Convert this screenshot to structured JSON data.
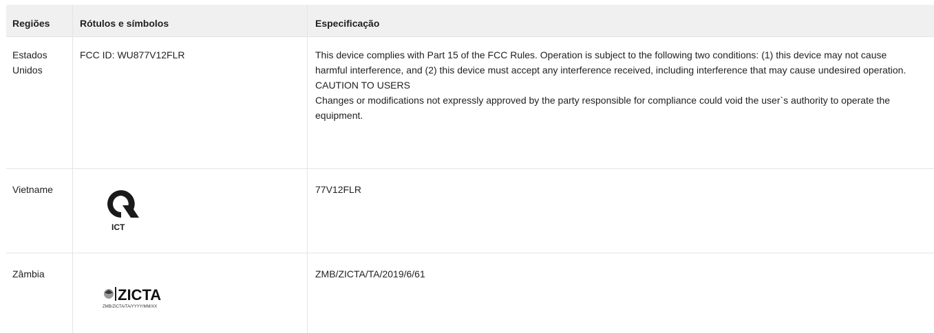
{
  "table": {
    "headers": [
      "Regiões",
      "Rótulos e símbolos",
      "Especificação"
    ],
    "rows": [
      {
        "region": "Estados Unidos",
        "label": "FCC ID: WU877V12FLR",
        "spec": [
          "This device complies with Part 15 of the FCC Rules. Operation is subject to the following two conditions: (1) this device may not cause harmful interference, and (2) this device must accept any interference received, including interference that may cause undesired operation.",
          "CAUTION TO USERS",
          "Changes or modifications not expressly approved by the party responsible for compliance could void the user`s authority to operate the equipment."
        ]
      },
      {
        "region": "Vietname",
        "logo_icon": "ict-logo",
        "logo_text": "ICT",
        "spec": [
          "77V12FLR"
        ]
      },
      {
        "region": "Zâmbia",
        "logo_icon": "zicta-logo",
        "logo_text": "ZICTA",
        "logo_subtext": "ZMB/ZICTA/TA/YYYY/MM/XX",
        "spec": [
          "ZMB/ZICTA/TA/2019/6/61"
        ]
      }
    ]
  }
}
